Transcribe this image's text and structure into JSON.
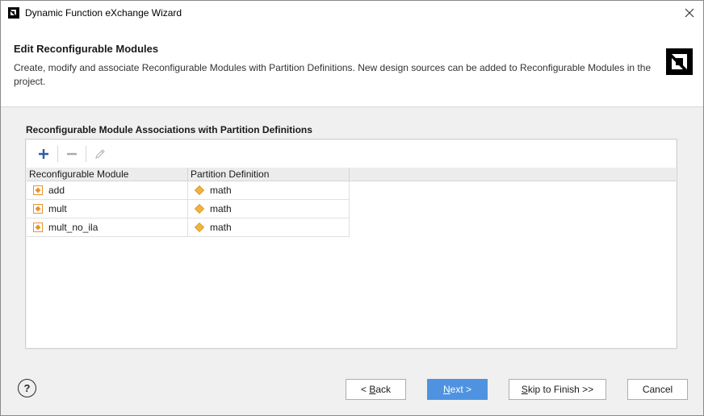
{
  "window": {
    "title": "Dynamic Function eXchange Wizard",
    "close_icon": "close-icon",
    "logo_icon": "app-logo-icon"
  },
  "header": {
    "title": "Edit Reconfigurable Modules",
    "description": "Create, modify and associate Reconfigurable Modules with Partition Definitions. New design sources can be added to Reconfigurable Modules in the project.",
    "brand_icon": "amd-logo-icon"
  },
  "section": {
    "label": "Reconfigurable Module Associations with Partition Definitions"
  },
  "toolbar": {
    "add_icon": "plus-icon",
    "remove_icon": "minus-icon",
    "edit_icon": "pencil-icon"
  },
  "table": {
    "columns": [
      "Reconfigurable Module",
      "Partition Definition"
    ],
    "rows": [
      {
        "module": "add",
        "partition": "math"
      },
      {
        "module": "mult",
        "partition": "math"
      },
      {
        "module": "mult_no_ila",
        "partition": "math"
      }
    ]
  },
  "footer": {
    "help_label": "?",
    "back_prefix": "< ",
    "back_mnemonic": "B",
    "back_rest": "ack",
    "next_mnemonic": "N",
    "next_rest": "ext >",
    "skip_mnemonic": "S",
    "skip_rest": "kip to Finish >>",
    "cancel_label": "Cancel"
  },
  "colors": {
    "accent": "#4f93e0",
    "module_icon": "#e8932a",
    "partition_icon": "#f0b43a",
    "toolbar_add": "#2a5caa"
  }
}
